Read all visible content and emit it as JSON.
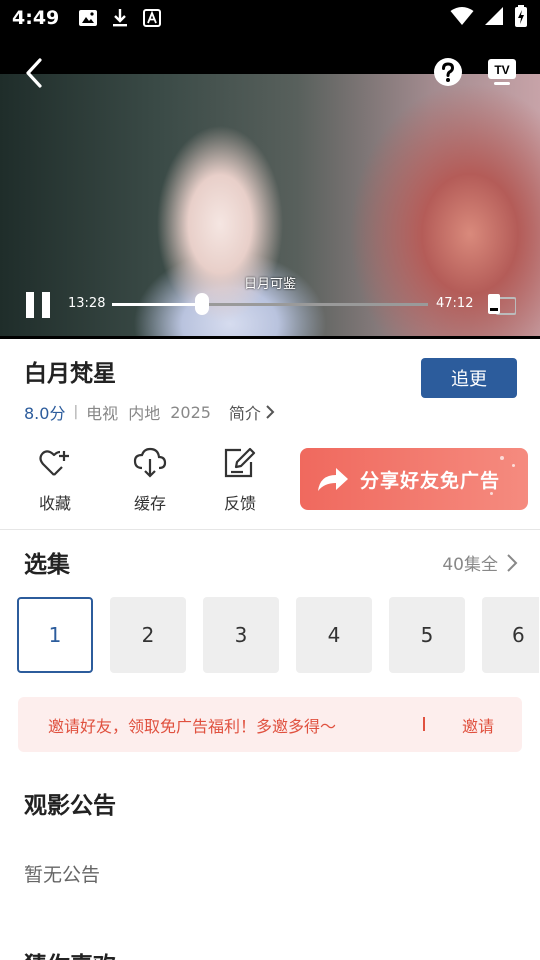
{
  "status_bar": {
    "time": "4:49",
    "left_icons": [
      "image-icon",
      "download-icon",
      "font-icon"
    ],
    "right_icons": [
      "wifi-icon",
      "signal-icon",
      "battery-charging-icon"
    ]
  },
  "player": {
    "subtitle": "日月可鉴",
    "current_time": "13:28",
    "total_time": "47:12",
    "progress": 0.285
  },
  "drama": {
    "title": "白月梵星",
    "score": "8.0分",
    "separator": "|",
    "type": "电视",
    "region": "内地",
    "year": "2025",
    "intro_label": "简介",
    "follow_label": "追更"
  },
  "actions": [
    {
      "label": "收藏",
      "icon": "heart-plus-icon"
    },
    {
      "label": "缓存",
      "icon": "cloud-download-icon"
    },
    {
      "label": "反馈",
      "icon": "edit-icon"
    }
  ],
  "share_banner": {
    "label": "分享好友免广告"
  },
  "episodes": {
    "section_title": "选集",
    "all_label": "40集全",
    "items": [
      "1",
      "2",
      "3",
      "4",
      "5",
      "6"
    ],
    "active": "1"
  },
  "invite": {
    "text": "邀请好友，领取免广告福利！多邀多得～",
    "action_label": "邀请"
  },
  "notice": {
    "section_title": "观影公告",
    "empty_text": "暂无公告"
  },
  "recommend": {
    "section_title": "猜你喜欢"
  },
  "colors": {
    "accent": "#2c5c9c",
    "invite_text": "#e0513f",
    "invite_bg": "#fdeeed",
    "share_banner": "#f0695e"
  }
}
